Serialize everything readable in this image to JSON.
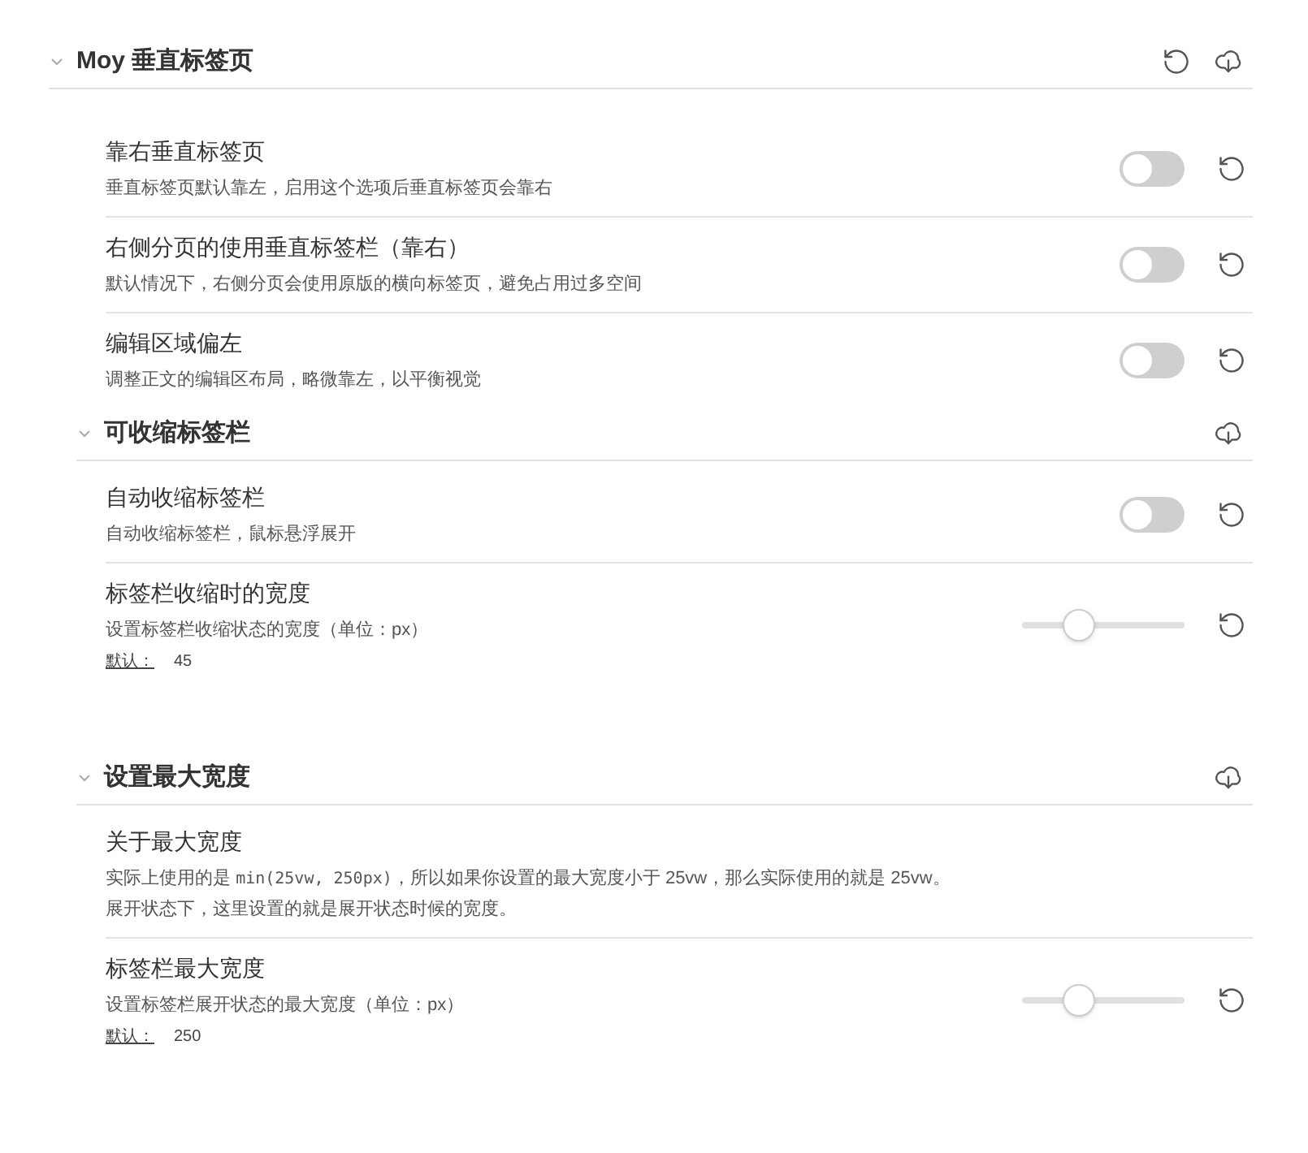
{
  "sections": [
    {
      "title": "Moy 垂直标签页",
      "expanded": true,
      "actions": [
        {
          "kind": "reset"
        },
        {
          "kind": "download"
        }
      ],
      "items": [
        {
          "kind": "toggle",
          "title": "靠右垂直标签页",
          "description": [
            [
              {
                "kind": "text",
                "text": "垂直标签页默认靠左，启用这个选项后垂直标签页会靠右"
              }
            ]
          ],
          "on": false
        },
        {
          "kind": "toggle",
          "title": "右侧分页的使用垂直标签栏（靠右）",
          "description": [
            [
              {
                "kind": "text",
                "text": "默认情况下，右侧分页会使用原版的横向标签页，避免占用过多空间"
              }
            ]
          ],
          "on": false
        },
        {
          "kind": "toggle",
          "title": "编辑区域偏左",
          "description": [
            [
              {
                "kind": "text",
                "text": "调整正文的编辑区布局，略微靠左，以平衡视觉"
              }
            ]
          ],
          "on": false
        }
      ]
    },
    {
      "title": "可收缩标签栏",
      "expanded": true,
      "actions": [
        {
          "kind": "download"
        }
      ],
      "items": [
        {
          "kind": "toggle",
          "title": "自动收缩标签栏",
          "description": [
            [
              {
                "kind": "text",
                "text": "自动收缩标签栏，鼠标悬浮展开"
              }
            ]
          ],
          "on": false
        },
        {
          "kind": "slider",
          "title": "标签栏收缩时的宽度",
          "description": [
            [
              {
                "kind": "text",
                "text": "设置标签栏收缩状态的宽度（单位：px）"
              }
            ]
          ],
          "default_label": "默认：",
          "default_value": "45",
          "level": 0.35
        }
      ]
    },
    {
      "title": "设置最大宽度",
      "expanded": true,
      "actions": [
        {
          "kind": "download"
        }
      ],
      "items": [
        {
          "kind": "info",
          "title": "关于最大宽度",
          "description": [
            [
              {
                "kind": "text",
                "text": "实际上使用的是 "
              },
              {
                "kind": "code",
                "text": "min(25vw, 250px)"
              },
              {
                "kind": "text",
                "text": "，所以如果你设置的最大宽度小于 25vw，那么实际使用的就是 25vw。"
              }
            ],
            [
              {
                "kind": "text",
                "text": "展开状态下，这里设置的就是展开状态时候的宽度。"
              }
            ]
          ]
        },
        {
          "kind": "slider",
          "title": "标签栏最大宽度",
          "description": [
            [
              {
                "kind": "text",
                "text": "设置标签栏展开状态的最大宽度（单位：px）"
              }
            ]
          ],
          "default_label": "默认：",
          "default_value": "250",
          "level": 0.35
        }
      ]
    }
  ]
}
